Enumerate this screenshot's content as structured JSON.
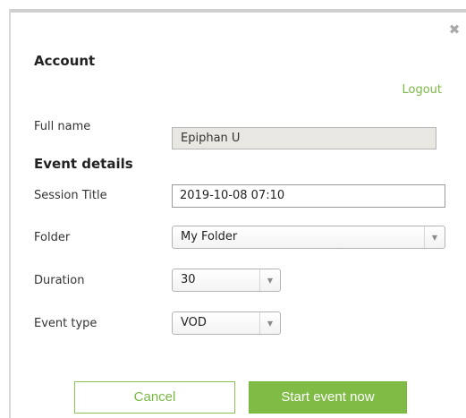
{
  "dialog": {
    "close_glyph": "✖",
    "account": {
      "title": "Account",
      "logout_label": "Logout",
      "full_name_label": "Full name",
      "full_name_value": "Epiphan U"
    },
    "event_details": {
      "title": "Event details",
      "session_title_label": "Session Title",
      "session_title_value": "2019-10-08 07:10",
      "folder_label": "Folder",
      "folder_value": "My Folder",
      "duration_label": "Duration",
      "duration_value": "30",
      "event_type_label": "Event type",
      "event_type_value": "VOD"
    },
    "buttons": {
      "cancel_label": "Cancel",
      "start_label": "Start event now"
    },
    "icons": {
      "close": "close-icon",
      "dropdown": "chevron-down-icon"
    },
    "colors": {
      "accent": "#7fbb45",
      "accent_text": "#7ab844",
      "readonly_bg": "#e8e7e1"
    }
  }
}
